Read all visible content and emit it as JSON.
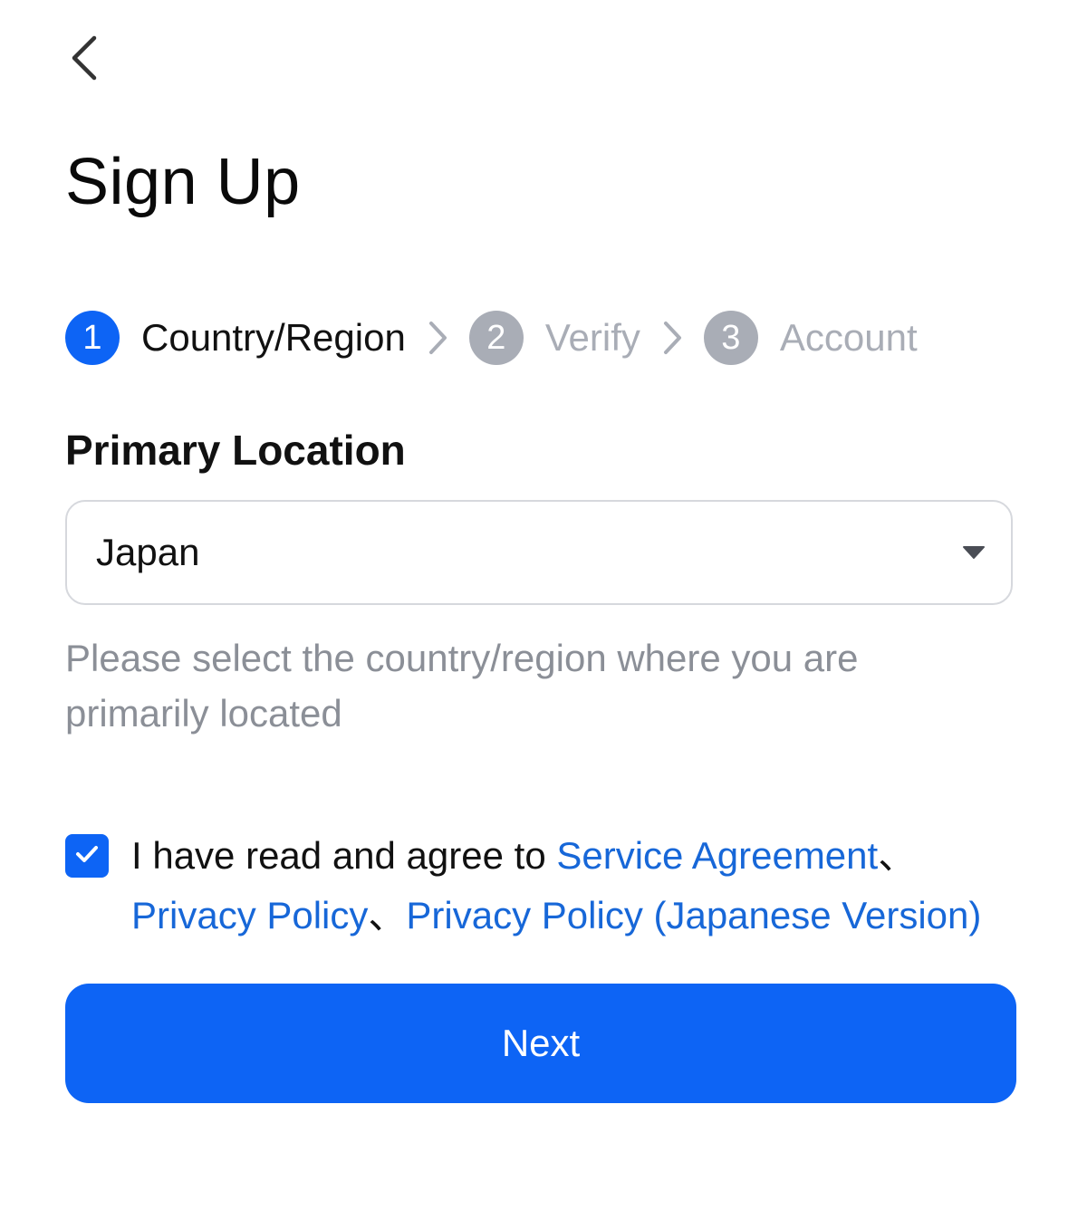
{
  "header": {
    "back_icon": "chevron-left-icon",
    "title": "Sign Up"
  },
  "steps": [
    {
      "number": "1",
      "label": "Country/Region",
      "state": "active"
    },
    {
      "number": "2",
      "label": "Verify",
      "state": "inactive"
    },
    {
      "number": "3",
      "label": "Account",
      "state": "inactive"
    }
  ],
  "location": {
    "label": "Primary Location",
    "selected_value": "Japan",
    "helper_text": "Please select the country/region where you are primarily located"
  },
  "agreement": {
    "checked": true,
    "prefix": "I have read and agree to ",
    "links": [
      "Service Agreement",
      "Privacy Policy",
      "Privacy Policy (Japanese Version)"
    ],
    "separator": "、"
  },
  "actions": {
    "next_label": "Next"
  },
  "colors": {
    "primary": "#0d64f5",
    "link": "#1767d8",
    "inactive": "#a9adb6",
    "helper_text": "#8b8f97",
    "border": "#d6d8dd"
  }
}
